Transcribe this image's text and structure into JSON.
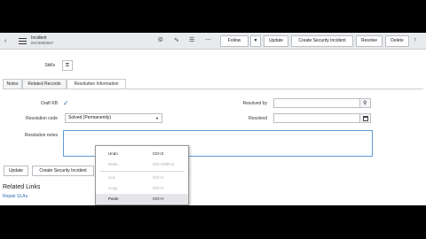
{
  "header": {
    "back_icon": "chevron-left",
    "menu_icon": "hamburger",
    "title": "Incident",
    "number": "INC0000057",
    "icons": [
      "paperclip",
      "activity",
      "settings",
      "more"
    ],
    "follow_label": "Follow",
    "update_label": "Update",
    "security_label": "Create Security Incident",
    "resolve_label": "Resolve",
    "delete_label": "Delete",
    "up_icon": "arrow-up"
  },
  "skills": {
    "label": "Skills"
  },
  "tabs": [
    {
      "label": "Notes"
    },
    {
      "label": "Related Records"
    },
    {
      "label": "Resolution Information",
      "active": true
    }
  ],
  "form": {
    "draft_kb_label": "Draft KB",
    "resolution_code_label": "Resolution code",
    "resolution_code_value": "Solved (Permanently)",
    "resolution_notes_label": "Resolution notes",
    "resolved_by_label": "Resolved by",
    "resolved_label": "Resolved"
  },
  "bottom": {
    "update_label": "Update",
    "security_label": "Create Security Incident",
    "related_links_title": "Related Links",
    "repair_link": "Repair SLAs"
  },
  "context_menu": [
    {
      "label": "Undo",
      "shortcut": "Ctrl+Z",
      "enabled": true
    },
    {
      "label": "Redo",
      "shortcut": "Ctrl+Shift+Z",
      "enabled": false
    },
    {
      "label": "Cut",
      "shortcut": "Ctrl+X",
      "enabled": false
    },
    {
      "label": "Copy",
      "shortcut": "Ctrl+C",
      "enabled": false
    },
    {
      "label": "Paste",
      "shortcut": "Ctrl+V",
      "enabled": true,
      "highlighted": true
    }
  ],
  "colors": {
    "accent": "#1f8476",
    "link": "#2f6fb0",
    "checkbox": "#2a6cb5"
  }
}
